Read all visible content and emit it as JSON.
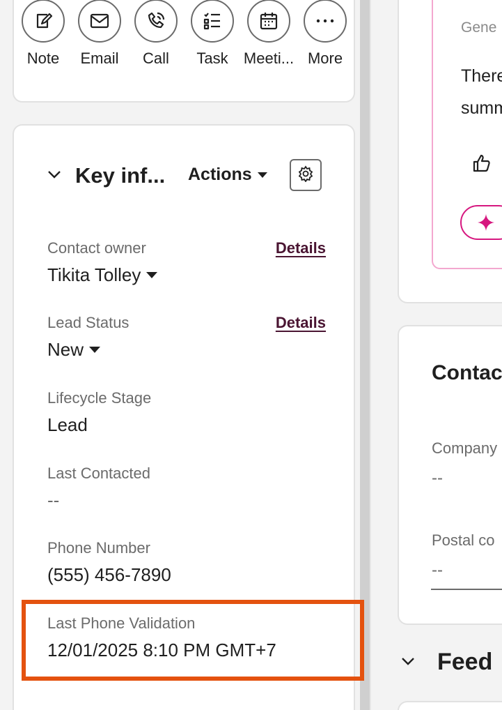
{
  "activities": [
    {
      "label": "Note",
      "icon": "note-icon"
    },
    {
      "label": "Email",
      "icon": "email-icon"
    },
    {
      "label": "Call",
      "icon": "call-icon"
    },
    {
      "label": "Task",
      "icon": "task-icon"
    },
    {
      "label": "Meeti...",
      "icon": "meeting-icon"
    },
    {
      "label": "More",
      "icon": "more-icon"
    }
  ],
  "key_info": {
    "title": "Key inf...",
    "actions_label": "Actions",
    "properties": [
      {
        "label": "Contact owner",
        "value": "Tikita Tolley",
        "dropdown": true,
        "details": "Details"
      },
      {
        "label": "Lead Status",
        "value": "New",
        "dropdown": true,
        "details": "Details"
      },
      {
        "label": "Lifecycle Stage",
        "value": "Lead"
      },
      {
        "label": "Last Contacted",
        "value": "--"
      },
      {
        "label": "Phone Number",
        "value": "(555) 456-7890"
      },
      {
        "label": "Last Phone Validation",
        "value": "12/01/2025 8:10 PM GMT+7"
      }
    ]
  },
  "ai_summary": {
    "subtitle": "Gene",
    "text_line1": "There",
    "text_line2": "summ"
  },
  "contact_card": {
    "title": "Contac",
    "company_label": "Company",
    "company_value": "--",
    "postal_label": "Postal co",
    "postal_value": "--"
  },
  "feed": {
    "title": "Feed"
  },
  "colors": {
    "highlight": "#e4520f",
    "link": "#4a1532",
    "ai_accent": "#d6177f"
  }
}
